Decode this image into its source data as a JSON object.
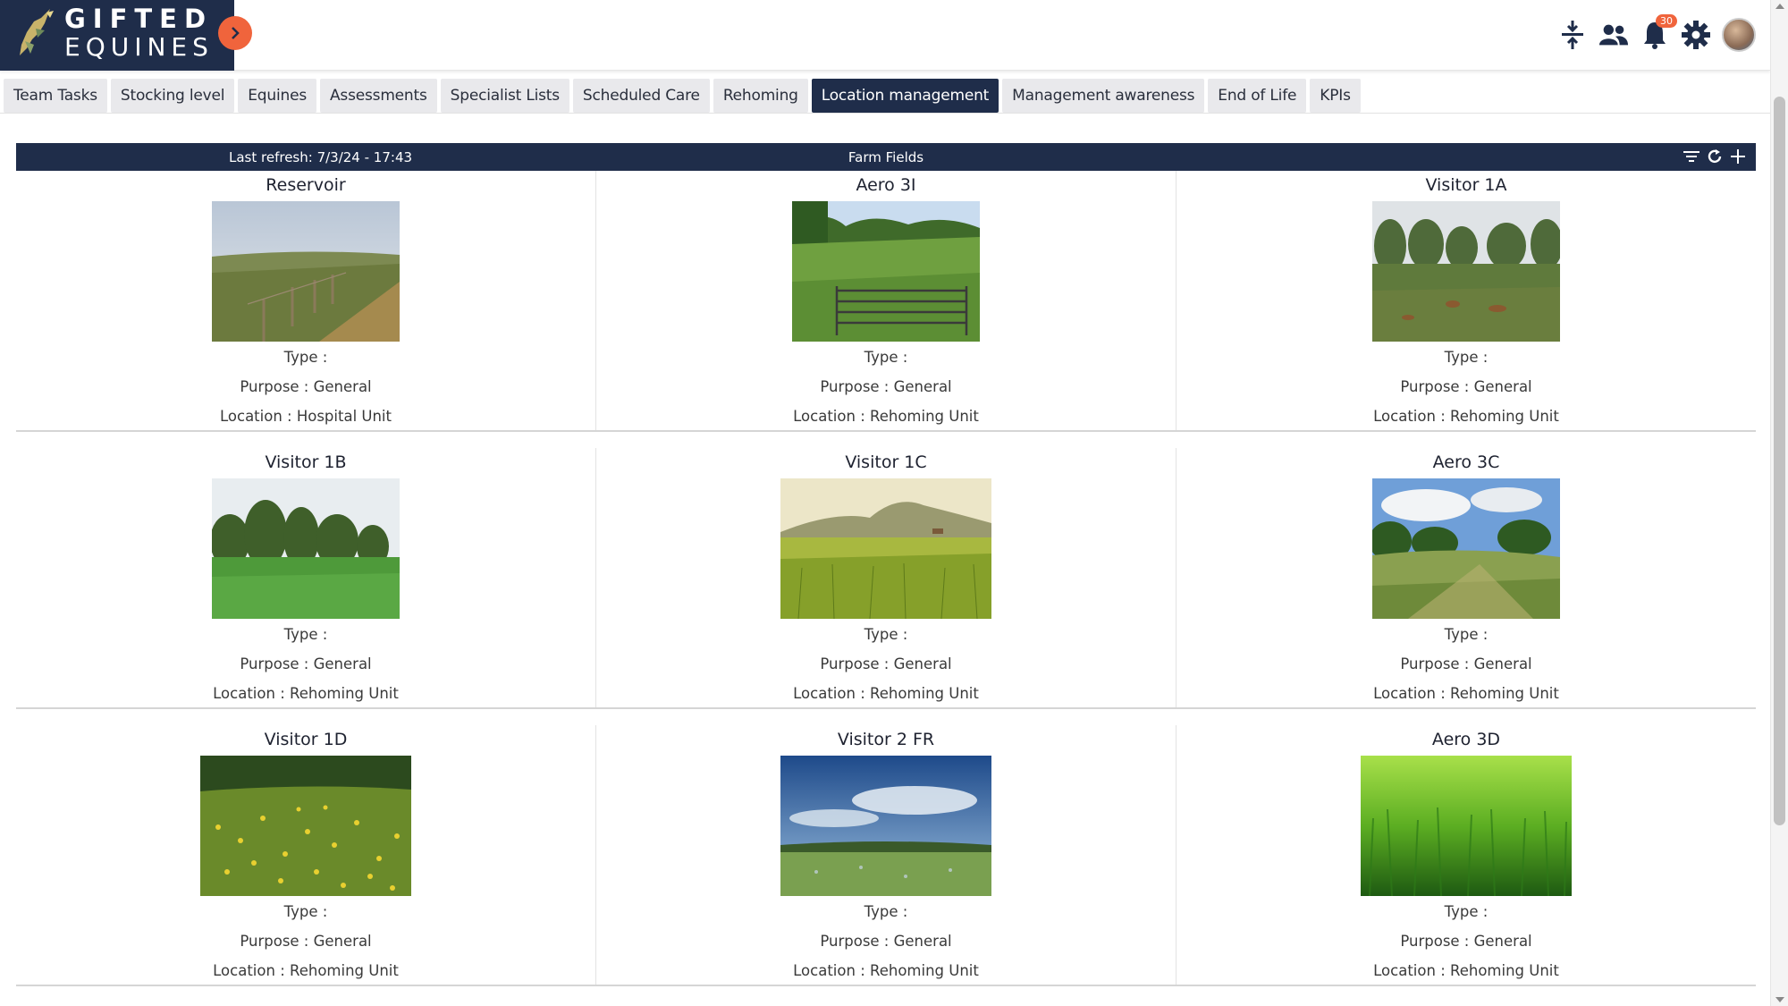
{
  "brand": {
    "line1": "GIFTED",
    "line2": "EQUINES"
  },
  "header": {
    "notifications_count": "30",
    "icons": [
      "compress-icon",
      "team-icon",
      "bell-icon",
      "gear-icon",
      "avatar"
    ]
  },
  "tabs": [
    {
      "label": "Team Tasks"
    },
    {
      "label": "Stocking level"
    },
    {
      "label": "Equines"
    },
    {
      "label": "Assessments"
    },
    {
      "label": "Specialist Lists"
    },
    {
      "label": "Scheduled Care"
    },
    {
      "label": "Rehoming"
    },
    {
      "label": "Location management",
      "active": true
    },
    {
      "label": "Management awareness"
    },
    {
      "label": "End of Life"
    },
    {
      "label": "KPIs"
    }
  ],
  "panel": {
    "refresh": "Last refresh: 7/3/24 - 17:43",
    "title": "Farm Fields"
  },
  "fields": [
    {
      "name": "Reservoir",
      "type": "Type :",
      "purpose": "Purpose : General",
      "location": "Location : Hospital Unit"
    },
    {
      "name": "Aero 3I",
      "type": "Type :",
      "purpose": "Purpose : General",
      "location": "Location : Rehoming Unit"
    },
    {
      "name": "Visitor 1A",
      "type": "Type :",
      "purpose": "Purpose : General",
      "location": "Location : Rehoming Unit"
    },
    {
      "name": "Visitor 1B",
      "type": "Type :",
      "purpose": "Purpose : General",
      "location": "Location : Rehoming Unit"
    },
    {
      "name": "Visitor 1C",
      "type": "Type :",
      "purpose": "Purpose : General",
      "location": "Location : Rehoming Unit"
    },
    {
      "name": "Aero 3C",
      "type": "Type :",
      "purpose": "Purpose : General",
      "location": "Location : Rehoming Unit"
    },
    {
      "name": "Visitor 1D",
      "type": "Type :",
      "purpose": "Purpose : General",
      "location": "Location : Rehoming Unit"
    },
    {
      "name": "Visitor 2 FR",
      "type": "Type :",
      "purpose": "Purpose : General",
      "location": "Location : Rehoming Unit"
    },
    {
      "name": "Aero 3D",
      "type": "Type :",
      "purpose": "Purpose : General",
      "location": "Location : Rehoming Unit"
    }
  ],
  "colors": {
    "navy": "#1f2d4a",
    "accent": "#f0643c",
    "tab_bg": "#e9e9ec"
  }
}
